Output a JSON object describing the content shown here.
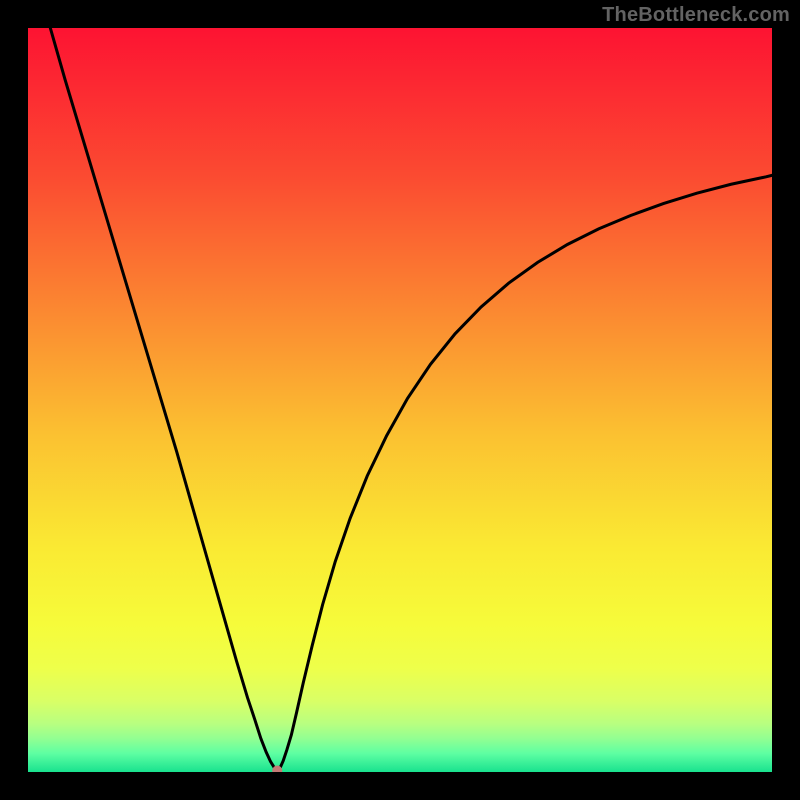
{
  "attribution": "TheBottleneck.com",
  "chart_data": {
    "type": "line",
    "title": "",
    "xlabel": "",
    "ylabel": "",
    "xlim": [
      0,
      100
    ],
    "ylim": [
      0,
      100
    ],
    "series": [
      {
        "name": "bottleneck-curve",
        "x": [
          3,
          5,
          8,
          11,
          14,
          17,
          20,
          22,
          24,
          26,
          28,
          29.5,
          30.5,
          31.3,
          32,
          32.6,
          33.1,
          33.5,
          33.9,
          34.3,
          34.8,
          35.4,
          36.1,
          37,
          38.2,
          39.6,
          41.3,
          43.3,
          45.6,
          48.2,
          51,
          54.1,
          57.4,
          60.9,
          64.6,
          68.5,
          72.5,
          76.7,
          81,
          85.4,
          89.9,
          94.5,
          99.2,
          100
        ],
        "y": [
          100,
          93,
          83,
          73,
          63,
          53,
          43,
          36,
          29,
          22,
          15,
          10,
          7,
          4.5,
          2.7,
          1.4,
          0.6,
          0.2,
          0.6,
          1.5,
          3,
          5,
          8,
          12,
          17,
          22.5,
          28.3,
          34.1,
          39.8,
          45.2,
          50.2,
          54.8,
          58.9,
          62.5,
          65.7,
          68.5,
          70.9,
          73,
          74.8,
          76.4,
          77.8,
          79,
          80,
          80.2
        ]
      }
    ],
    "marker": {
      "x": 33.5,
      "y": 0.2
    },
    "gradient_stops": [
      {
        "offset": 0.0,
        "color": "#fd1332"
      },
      {
        "offset": 0.2,
        "color": "#fb4b31"
      },
      {
        "offset": 0.4,
        "color": "#fb8f31"
      },
      {
        "offset": 0.55,
        "color": "#fbc231"
      },
      {
        "offset": 0.7,
        "color": "#faea33"
      },
      {
        "offset": 0.8,
        "color": "#f6fb3a"
      },
      {
        "offset": 0.86,
        "color": "#eeff4a"
      },
      {
        "offset": 0.905,
        "color": "#d9ff66"
      },
      {
        "offset": 0.935,
        "color": "#b8ff80"
      },
      {
        "offset": 0.955,
        "color": "#92ff92"
      },
      {
        "offset": 0.975,
        "color": "#5effa2"
      },
      {
        "offset": 1.0,
        "color": "#19e28f"
      }
    ]
  }
}
